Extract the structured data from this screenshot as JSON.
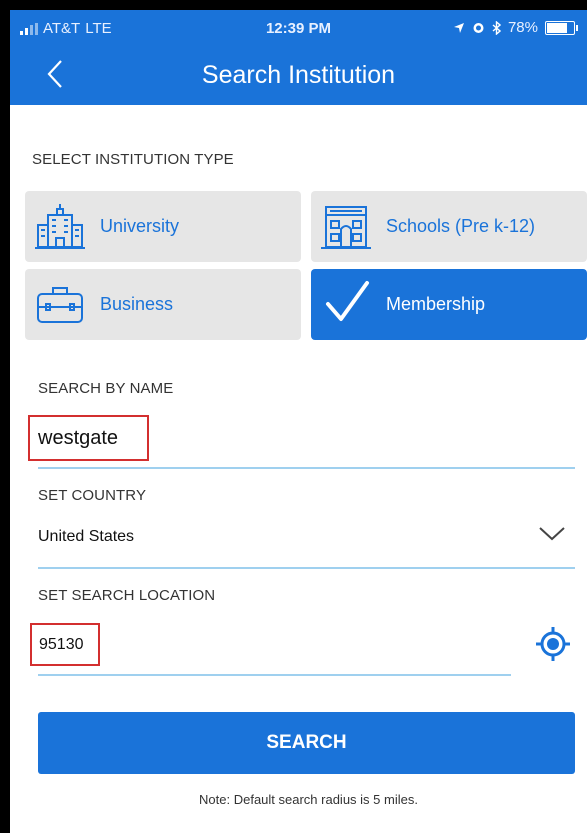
{
  "status_bar": {
    "carrier": "AT&T",
    "network": "LTE",
    "time": "12:39 PM",
    "battery": "78%",
    "battery_level": 0.78,
    "icons": [
      "signal-icon",
      "location-arrow-icon",
      "alarm-icon",
      "bluetooth-icon",
      "battery-icon"
    ]
  },
  "header": {
    "title": "Search Institution",
    "back_icon": "chevron-left-icon"
  },
  "institution_type": {
    "label": "SELECT INSTITUTION TYPE",
    "options": [
      {
        "label": "University",
        "icon": "university-building-icon",
        "selected": false
      },
      {
        "label": "Schools (Pre k-12)",
        "icon": "school-building-icon",
        "selected": false
      },
      {
        "label": "Business",
        "icon": "briefcase-icon",
        "selected": false
      },
      {
        "label": "Membership",
        "icon": "checkmark-icon",
        "selected": true
      }
    ]
  },
  "search_by_name": {
    "label": "SEARCH BY NAME",
    "value": "westgate"
  },
  "country": {
    "label": "SET COUNTRY",
    "value": "United States",
    "dropdown_icon": "chevron-down-icon"
  },
  "location": {
    "label": "SET SEARCH LOCATION",
    "value": "95130",
    "locate_icon": "crosshair-icon"
  },
  "search_button": {
    "label": "SEARCH"
  },
  "note": "Note: Default search radius is 5 miles.",
  "colors": {
    "primary": "#1a73d9",
    "card_bg": "#e6e6e6",
    "highlight_border": "#d32f2f",
    "input_underline": "#9fd0ef"
  }
}
